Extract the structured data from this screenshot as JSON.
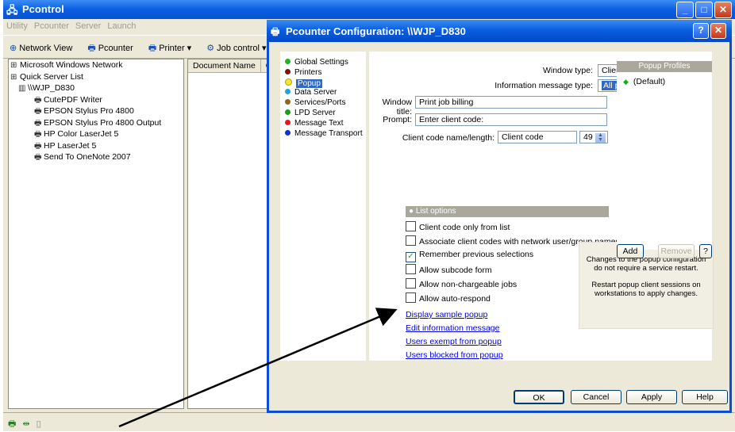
{
  "bg": {
    "title": "Pcontrol",
    "menu": [
      "Utility",
      "Pcounter",
      "Server",
      "Launch"
    ],
    "toolbar": [
      "Network View",
      "Pcounter",
      "Printer ▾",
      "Job control ▾"
    ],
    "tree": [
      {
        "label": "Microsoft Windows Network",
        "icon": "network-icon",
        "indent": 0
      },
      {
        "label": "Quick Server List",
        "icon": "network-icon",
        "indent": 0
      },
      {
        "label": "\\\\WJP_D830",
        "icon": "server-icon",
        "indent": 1
      },
      {
        "label": "CutePDF Writer",
        "icon": "printer-icon",
        "indent": 2
      },
      {
        "label": "EPSON Stylus Pro 4800",
        "icon": "printer-icon",
        "indent": 2
      },
      {
        "label": "EPSON Stylus Pro 4800 Output",
        "icon": "printer-icon",
        "indent": 2
      },
      {
        "label": "HP Color LaserJet 5",
        "icon": "printer-icon",
        "indent": 2
      },
      {
        "label": "HP LaserJet 5",
        "icon": "printer-icon",
        "indent": 2
      },
      {
        "label": "Send To OneNote 2007",
        "icon": "printer-icon",
        "indent": 2
      }
    ],
    "list_columns": [
      "Document Name",
      "Own"
    ]
  },
  "dialog": {
    "title": "Pcounter Configuration: \\\\WJP_D830",
    "nav": [
      {
        "label": "Global Settings",
        "color": "#22b422"
      },
      {
        "label": "Printers",
        "color": "#7a1515"
      },
      {
        "label": "Popup",
        "color": "#f5e62a",
        "selected": true
      },
      {
        "label": "Data Server",
        "color": "#1fa3d8"
      },
      {
        "label": "Services/Ports",
        "color": "#8a6a1a"
      },
      {
        "label": "LPD Server",
        "color": "#14a014"
      },
      {
        "label": "Message Text",
        "color": "#e01a1a"
      },
      {
        "label": "Message Transport",
        "color": "#1530c8"
      }
    ],
    "window_type_label": "Window type:",
    "window_type_value": "Client code list",
    "info_msg_label": "Information message type:",
    "info_msg_value": "All printers",
    "window_title_label": "Window title:",
    "window_title_value": "Print job billing",
    "prompt_label": "Prompt:",
    "prompt_value": "Enter client code:",
    "client_code_label": "Client code name/length:",
    "client_code_value": "Client code",
    "client_code_length": "49",
    "list_options_header": "● List options",
    "options": [
      {
        "label": "Client code only from list",
        "checked": false
      },
      {
        "label": "Associate client codes with network user/group names",
        "checked": false
      },
      {
        "label": "Remember previous selections",
        "checked": true
      },
      {
        "label": "Allow subcode form",
        "checked": false
      },
      {
        "label": "Allow non-chargeable jobs",
        "checked": false
      },
      {
        "label": "Allow auto-respond",
        "checked": false
      }
    ],
    "links": [
      "Display sample popup",
      "Edit information message",
      "Users exempt from popup",
      "Users blocked from popup"
    ],
    "info_text_1": "Changes to the popup configuration do not require a service restart.",
    "info_text_2": "Restart popup client sessions on workstations to apply changes.",
    "profiles_header": "Popup Profiles",
    "profile_default": "(Default)",
    "add_label": "Add",
    "remove_label": "Remove",
    "help_q": "?",
    "ok_label": "OK",
    "cancel_label": "Cancel",
    "apply_label": "Apply",
    "help_label": "Help"
  }
}
